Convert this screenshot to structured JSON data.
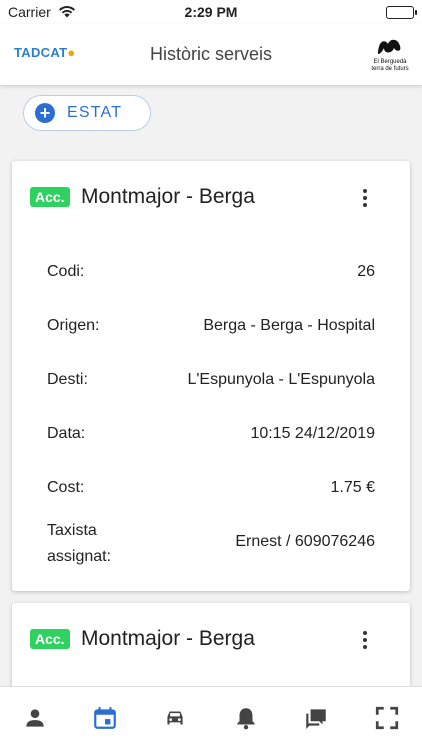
{
  "status_bar": {
    "carrier": "Carrier",
    "time": "2:29 PM"
  },
  "header": {
    "title": "Històric serveis",
    "logo_left": "TADCAT",
    "logo_right_line1": "El Berguedà",
    "logo_right_line2": "terra de futurs"
  },
  "filter": {
    "label": "ESTAT"
  },
  "cards": [
    {
      "badge": "Acc.",
      "title": "Montmajor - Berga",
      "rows": [
        {
          "label": "Codi:",
          "value": "26"
        },
        {
          "label": "Origen:",
          "value": "Berga - Berga - Hospital"
        },
        {
          "label": "Desti:",
          "value": "L'Espunyola - L'Espunyola"
        },
        {
          "label": "Data:",
          "value": "10:15 24/12/2019"
        },
        {
          "label": "Cost:",
          "value": "1.75 €"
        },
        {
          "label": "Taxista",
          "label2": "assignat:",
          "value": "Ernest / 609076246"
        }
      ]
    },
    {
      "badge": "Acc.",
      "title": "Montmajor - Berga"
    }
  ],
  "tabs": [
    {
      "icon": "person-icon",
      "active": false
    },
    {
      "icon": "calendar-icon",
      "active": true
    },
    {
      "icon": "car-icon",
      "active": false
    },
    {
      "icon": "bell-icon",
      "active": false
    },
    {
      "icon": "messages-icon",
      "active": false
    },
    {
      "icon": "fullscreen-icon",
      "active": false
    }
  ],
  "colors": {
    "accent": "#2c6fd1",
    "badge": "#2fd160",
    "icon": "#444444"
  }
}
